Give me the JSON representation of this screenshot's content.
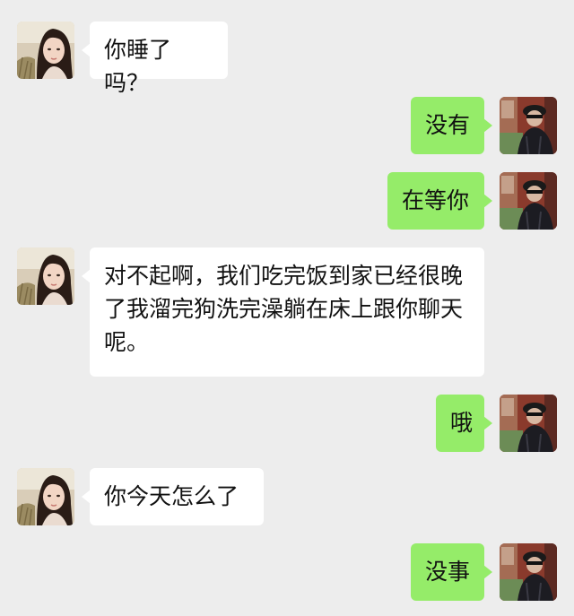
{
  "colors": {
    "background": "#ededed",
    "incoming_bubble": "#ffffff",
    "outgoing_bubble": "#95ec69",
    "text": "#111111"
  },
  "messages": [
    {
      "sender": "her",
      "text": "你睡了吗？"
    },
    {
      "sender": "me",
      "text": "没有"
    },
    {
      "sender": "me",
      "text": "在等你"
    },
    {
      "sender": "her",
      "text": "对不起啊，我们吃完饭到家已经很晚了我溜完狗洗完澡躺在床上跟你聊天呢。"
    },
    {
      "sender": "me",
      "text": "哦"
    },
    {
      "sender": "her",
      "text": "你今天怎么了"
    },
    {
      "sender": "me",
      "text": "没事"
    }
  ]
}
